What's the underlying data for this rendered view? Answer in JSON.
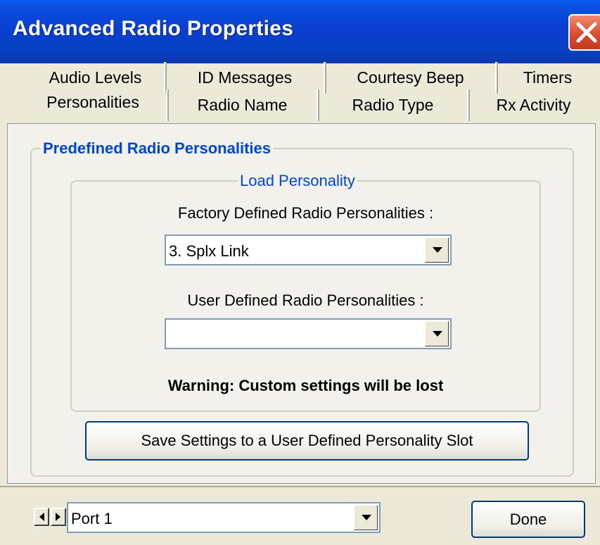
{
  "window": {
    "title": "Advanced Radio Properties"
  },
  "tabs": {
    "row1": [
      "Audio Levels",
      "ID Messages",
      "Courtesy Beep",
      "Timers"
    ],
    "row2": [
      "Personalities",
      "Radio Name",
      "Radio Type",
      "Rx Activity"
    ],
    "active": "Personalities"
  },
  "panel": {
    "group_title": "Predefined Radio Personalities",
    "load_group_title": "Load Personality",
    "factory_label": "Factory Defined Radio Personalities :",
    "factory_value": "3. Splx Link",
    "user_label": "User Defined Radio Personalities :",
    "user_value": "",
    "warning": "Warning: Custom settings will be lost",
    "save_button": "Save Settings to a User Defined Personality Slot"
  },
  "footer": {
    "port_value": "Port 1",
    "done_button": "Done"
  },
  "icons": {
    "close": "close-icon",
    "dropdown": "chevron-down-icon",
    "prev": "arrow-left-icon",
    "next": "arrow-right-icon"
  },
  "colors": {
    "titlebar": "#0a46d8",
    "legend_blue": "#0046d5",
    "close_red": "#d9482b"
  }
}
